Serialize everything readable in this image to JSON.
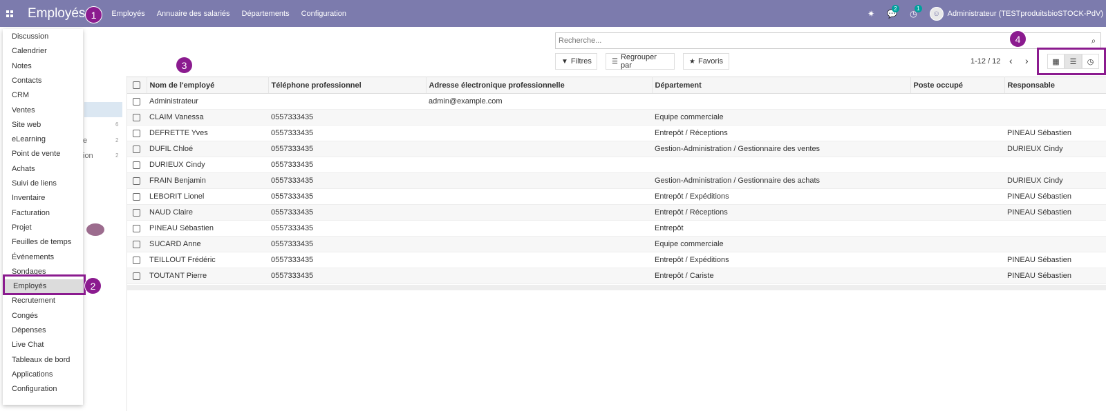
{
  "navbar": {
    "brand": "Employés",
    "menu": [
      "Employés",
      "Annuaire des salariés",
      "Départements",
      "Configuration"
    ],
    "chat_badge": "2",
    "activity_badge": "1",
    "user": "Administrateur (TESTproduitsbioSTOCK-PdV)"
  },
  "markers": [
    "1",
    "2",
    "3",
    "4"
  ],
  "search": {
    "placeholder": "Recherche..."
  },
  "buttons": {
    "filters": "Filtres",
    "group_by": "Regrouper par",
    "favorites": "Favoris"
  },
  "pager": {
    "value": "1-12 / 12"
  },
  "sidebar": {
    "partials": [
      {
        "text": "e",
        "count": "2"
      },
      {
        "text": "ion",
        "count": "2"
      }
    ],
    "first_count": "6"
  },
  "app_menu": [
    "Discussion",
    "Calendrier",
    "Notes",
    "Contacts",
    "CRM",
    "Ventes",
    "Site web",
    "eLearning",
    "Point de vente",
    "Achats",
    "Suivi de liens",
    "Inventaire",
    "Facturation",
    "Projet",
    "Feuilles de temps",
    "Événements",
    "Sondages",
    "Employés",
    "Recrutement",
    "Congés",
    "Dépenses",
    "Live Chat",
    "Tableaux de bord",
    "Applications",
    "Configuration"
  ],
  "table": {
    "headers": [
      "Nom de l'employé",
      "Téléphone professionnel",
      "Adresse électronique professionnelle",
      "Département",
      "Poste occupé",
      "Responsable"
    ],
    "rows": [
      [
        "Administrateur",
        "",
        "admin@example.com",
        "",
        "",
        ""
      ],
      [
        "CLAIM Vanessa",
        "0557333435",
        "",
        "Equipe commerciale",
        "",
        ""
      ],
      [
        "DEFRETTE Yves",
        "0557333435",
        "",
        "Entrepôt / Réceptions",
        "",
        "PINEAU Sébastien"
      ],
      [
        "DUFIL Chloé",
        "0557333435",
        "",
        "Gestion-Administration / Gestionnaire des ventes",
        "",
        "DURIEUX Cindy"
      ],
      [
        "DURIEUX Cindy",
        "0557333435",
        "",
        "",
        "",
        ""
      ],
      [
        "FRAIN Benjamin",
        "0557333435",
        "",
        "Gestion-Administration / Gestionnaire des achats",
        "",
        "DURIEUX Cindy"
      ],
      [
        "LEBORIT Lionel",
        "0557333435",
        "",
        "Entrepôt / Expéditions",
        "",
        "PINEAU Sébastien"
      ],
      [
        "NAUD Claire",
        "0557333435",
        "",
        "Entrepôt / Réceptions",
        "",
        "PINEAU Sébastien"
      ],
      [
        "PINEAU Sébastien",
        "0557333435",
        "",
        "Entrepôt",
        "",
        ""
      ],
      [
        "SUCARD Anne",
        "0557333435",
        "",
        "Equipe commerciale",
        "",
        ""
      ],
      [
        "TEILLOUT Frédéric",
        "0557333435",
        "",
        "Entrepôt / Expéditions",
        "",
        "PINEAU Sébastien"
      ],
      [
        "TOUTANT Pierre",
        "0557333435",
        "",
        "Entrepôt / Cariste",
        "",
        "PINEAU Sébastien"
      ]
    ]
  },
  "colors": {
    "navbar": "#7c7bad",
    "marker": "#8b1b8f",
    "badge": "#00a09d"
  }
}
